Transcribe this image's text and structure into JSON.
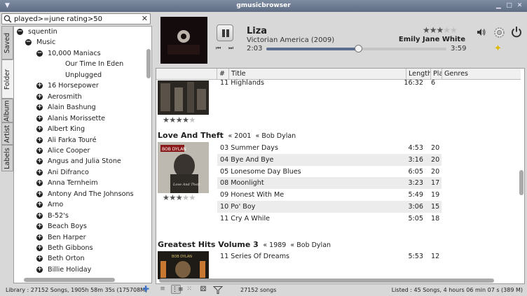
{
  "window": {
    "title": "gmusicbrowser"
  },
  "search": {
    "value": "played>=june rating>50"
  },
  "side_tabs": [
    "Saved",
    "Folder",
    "Album",
    "Artist",
    "Labels"
  ],
  "tree": {
    "items": [
      {
        "label": "squentin",
        "expander": "minus",
        "level": 0
      },
      {
        "label": "Music",
        "expander": "minus",
        "level": 1
      },
      {
        "label": "10,000 Maniacs",
        "expander": "minus",
        "level": 2
      },
      {
        "label": "Our Time In Eden",
        "expander": "none",
        "level": 3
      },
      {
        "label": "Unplugged",
        "expander": "none",
        "level": 3
      },
      {
        "label": "16 Horsepower",
        "expander": "plus",
        "level": 2
      },
      {
        "label": "Aerosmith",
        "expander": "plus",
        "level": 2
      },
      {
        "label": "Alain Bashung",
        "expander": "plus",
        "level": 2
      },
      {
        "label": "Alanis Morissette",
        "expander": "plus",
        "level": 2
      },
      {
        "label": "Albert King",
        "expander": "plus",
        "level": 2
      },
      {
        "label": "Ali Farka Touré",
        "expander": "plus",
        "level": 2
      },
      {
        "label": "Alice Cooper",
        "expander": "plus",
        "level": 2
      },
      {
        "label": "Angus and Julia Stone",
        "expander": "plus",
        "level": 2
      },
      {
        "label": "Ani Difranco",
        "expander": "plus",
        "level": 2
      },
      {
        "label": "Anna Ternheim",
        "expander": "plus",
        "level": 2
      },
      {
        "label": "Antony And The Johnsons",
        "expander": "plus",
        "level": 2
      },
      {
        "label": "Arno",
        "expander": "plus",
        "level": 2
      },
      {
        "label": "B-52's",
        "expander": "plus",
        "level": 2
      },
      {
        "label": "Beach Boys",
        "expander": "plus",
        "level": 2
      },
      {
        "label": "Ben Harper",
        "expander": "plus",
        "level": 2
      },
      {
        "label": "Beth Gibbons",
        "expander": "plus",
        "level": 2
      },
      {
        "label": "Beth Orton",
        "expander": "plus",
        "level": 2
      },
      {
        "label": "Billie Holiday",
        "expander": "plus",
        "level": 2
      }
    ]
  },
  "now_playing": {
    "title": "Liza",
    "album_year": "Victorian America (2009)",
    "artist": "Emily Jane White",
    "rating_stars": 3,
    "elapsed": "2:03",
    "total": "3:59",
    "progress": 0.514
  },
  "columns": {
    "num": "#",
    "title": "Title",
    "length": "Length",
    "plays": "Pla",
    "genres": "Genres"
  },
  "albums": [
    {
      "name": "",
      "year": "",
      "artist": "",
      "rating_stars": 4,
      "songs": [
        {
          "title": "11 Highlands",
          "length": "16:32",
          "plays": "6"
        }
      ]
    },
    {
      "name": "Love And Theft",
      "year": "2001",
      "artist": "Bob Dylan",
      "rating_stars": 3,
      "songs": [
        {
          "title": "03 Summer Days",
          "length": "4:53",
          "plays": "20"
        },
        {
          "title": "04 Bye And Bye",
          "length": "3:16",
          "plays": "20"
        },
        {
          "title": "05 Lonesome Day Blues",
          "length": "6:05",
          "plays": "20"
        },
        {
          "title": "08 Moonlight",
          "length": "3:23",
          "plays": "17"
        },
        {
          "title": "09 Honest With Me",
          "length": "5:49",
          "plays": "19"
        },
        {
          "title": "10 Po' Boy",
          "length": "3:06",
          "plays": "15"
        },
        {
          "title": "11 Cry A While",
          "length": "5:05",
          "plays": "18"
        }
      ]
    },
    {
      "name": "Greatest Hits Volume 3",
      "year": "1989",
      "artist": "Bob Dylan",
      "rating_stars": 0,
      "songs": [
        {
          "title": "11 Series Of Dreams",
          "length": "5:53",
          "plays": "12"
        }
      ]
    }
  ],
  "separator": "«",
  "cover_text": {
    "album2_top": "BOB DYLAN",
    "album2_bottom": "Love And Theft",
    "album3": "BOB DYLAN"
  },
  "status": {
    "library": "Library : 27152 Songs, 1905h 58m 35s (175708M)",
    "songs": "27152 songs",
    "listed": "Listed : 45 Songs, 4 hours 06 min 07 s (389 M)"
  },
  "icons": {
    "search": "search-icon",
    "clear": "clear-icon",
    "pause": "pause-icon",
    "prev": "previous-icon",
    "next": "next-icon",
    "volume": "volume-icon",
    "settings": "settings-gear-icon",
    "quit": "power-icon",
    "add": "add-icon"
  },
  "colors": {
    "accent": "#5a6d8d",
    "titlebar": "#6f7d94"
  }
}
